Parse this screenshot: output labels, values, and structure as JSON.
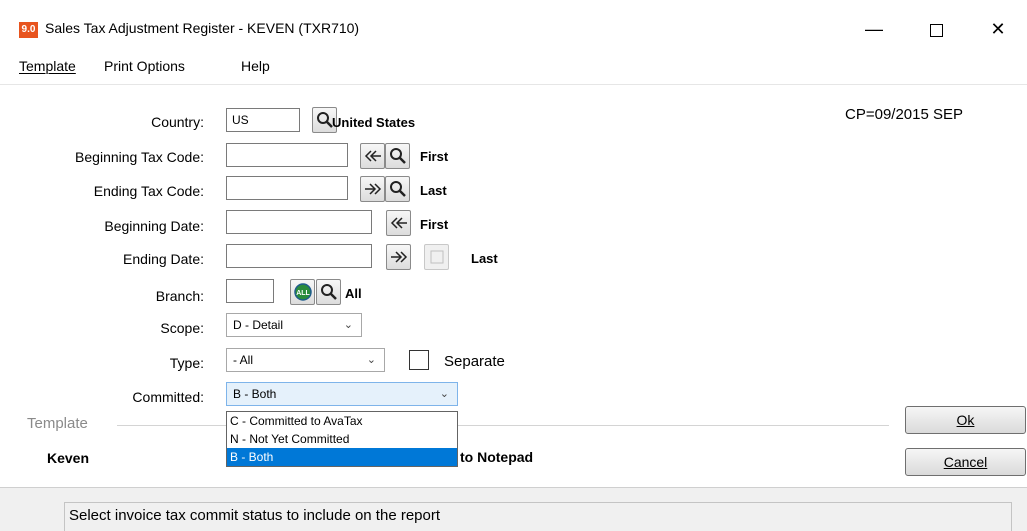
{
  "window": {
    "icon_text": "9.0",
    "title": "Sales Tax Adjustment Register - KEVEN (TXR710)",
    "minimize": "—",
    "close": "✕"
  },
  "menu": {
    "template": "Template",
    "print_options": "Print Options",
    "help": "Help"
  },
  "period": "CP=09/2015 SEP",
  "fields": {
    "country": {
      "label": "Country:",
      "value": "US",
      "lookup_text": "United States"
    },
    "beginning_tax_code": {
      "label": "Beginning Tax Code:",
      "value": "",
      "hint": "First"
    },
    "ending_tax_code": {
      "label": "Ending Tax Code:",
      "value": "",
      "hint": "Last"
    },
    "beginning_date": {
      "label": "Beginning Date:",
      "value": "",
      "hint": "First"
    },
    "ending_date": {
      "label": "Ending Date:",
      "value": "",
      "hint": "Last"
    },
    "branch": {
      "label": "Branch:",
      "value": "",
      "hint": "All"
    },
    "scope": {
      "label": "Scope:",
      "value": "D - Detail"
    },
    "type": {
      "label": "Type:",
      "value": "- All",
      "checkbox_label": "Separate"
    },
    "committed": {
      "label": "Committed:",
      "value": "B - Both",
      "options": [
        "C - Committed to AvaTax",
        "N - Not Yet Committed",
        "B - Both"
      ]
    }
  },
  "template_group": {
    "label": "Template",
    "name": "Keven",
    "obscured_text": "to Notepad"
  },
  "buttons": {
    "ok": "Ok",
    "cancel": "Cancel"
  },
  "status": "Select invoice tax commit status to include on the report",
  "colors": {
    "icon_bg": "#e8541e",
    "selected_bg": "#0078d7"
  }
}
